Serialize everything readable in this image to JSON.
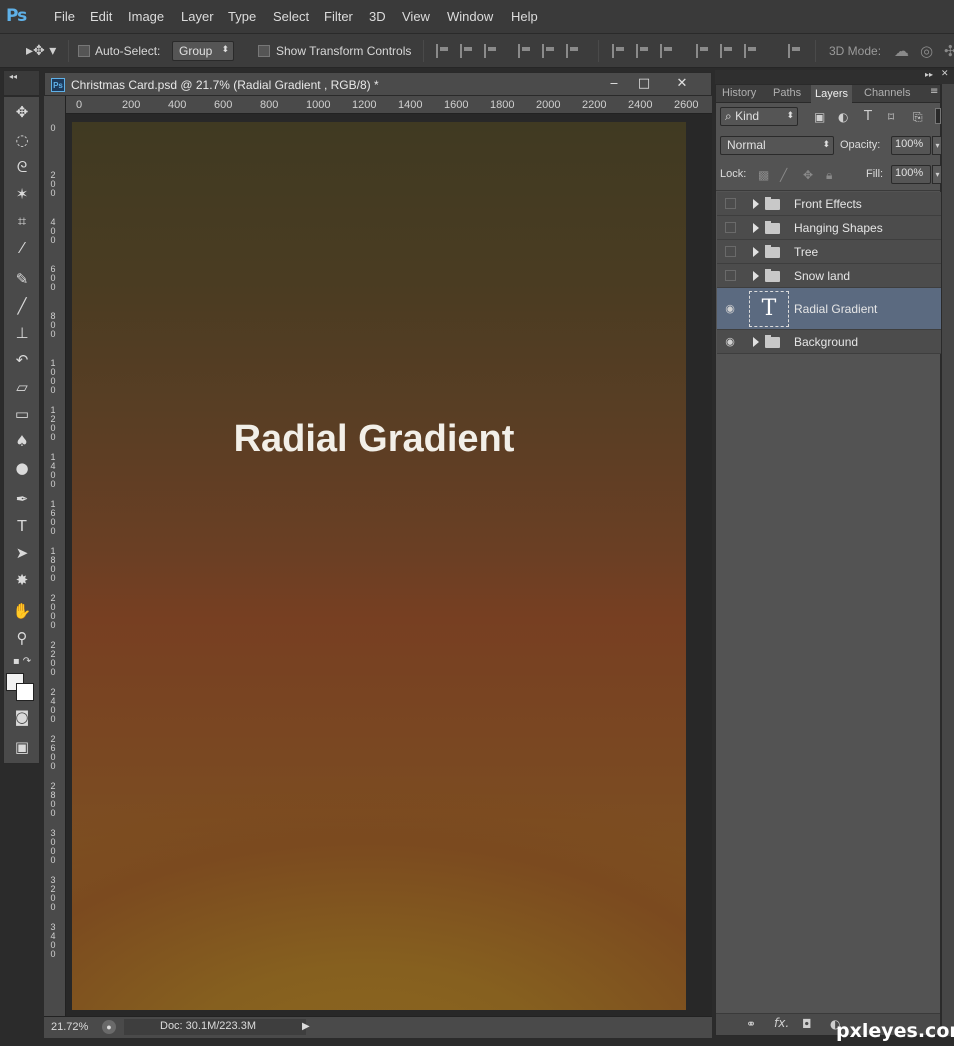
{
  "app": {
    "logo": "Ps",
    "accent": "#5fb1e8"
  },
  "menu": [
    "File",
    "Edit",
    "Image",
    "Layer",
    "Type",
    "Select",
    "Filter",
    "3D",
    "View",
    "Window",
    "Help"
  ],
  "options": {
    "auto_select_label": "Auto-Select:",
    "auto_select_value": "Group",
    "show_transform_label": "Show Transform Controls",
    "mode_3d_label": "3D Mode:"
  },
  "document": {
    "title": "Christmas Card.psd @ 21.7% (Radial Gradient , RGB/8) *",
    "ruler_h": [
      "0",
      "200",
      "400",
      "600",
      "800",
      "1000",
      "1200",
      "1400",
      "1600",
      "1800",
      "2000",
      "2200",
      "2400",
      "2600"
    ],
    "ruler_v": [
      "0",
      "2\n0\n0",
      "4\n0\n0",
      "6\n0\n0",
      "8\n0\n0",
      "1\n0\n0\n0",
      "1\n2\n0\n0",
      "1\n4\n0\n0",
      "1\n6\n0\n0",
      "1\n8\n0\n0",
      "2\n0\n0\n0",
      "2\n2\n0\n0",
      "2\n4\n0\n0",
      "2\n6\n0\n0",
      "2\n8\n0\n0",
      "3\n0\n0\n0",
      "3\n2\n0\n0",
      "3\n4\n0\n0"
    ],
    "canvas_text": "Radial Gradient"
  },
  "status": {
    "zoom": "21.72%",
    "doc": "Doc: 30.1M/223.3M"
  },
  "panel": {
    "tabs": [
      "History",
      "Paths",
      "Layers",
      "Channels"
    ],
    "active_tab": "Layers",
    "filter_kind": "Kind",
    "blend_mode": "Normal",
    "opacity_label": "Opacity:",
    "opacity": "100%",
    "lock_label": "Lock:",
    "fill_label": "Fill:",
    "fill": "100%",
    "layers": [
      {
        "name": "Front Effects",
        "type": "group",
        "visible": false
      },
      {
        "name": "Hanging Shapes",
        "type": "group",
        "visible": false
      },
      {
        "name": "Tree",
        "type": "group",
        "visible": false
      },
      {
        "name": "Snow land",
        "type": "group",
        "visible": false
      },
      {
        "name": "Radial Gradient",
        "type": "text",
        "visible": true,
        "selected": true
      },
      {
        "name": "Background",
        "type": "group",
        "visible": true
      }
    ]
  },
  "watermark": "pxleyes.com"
}
